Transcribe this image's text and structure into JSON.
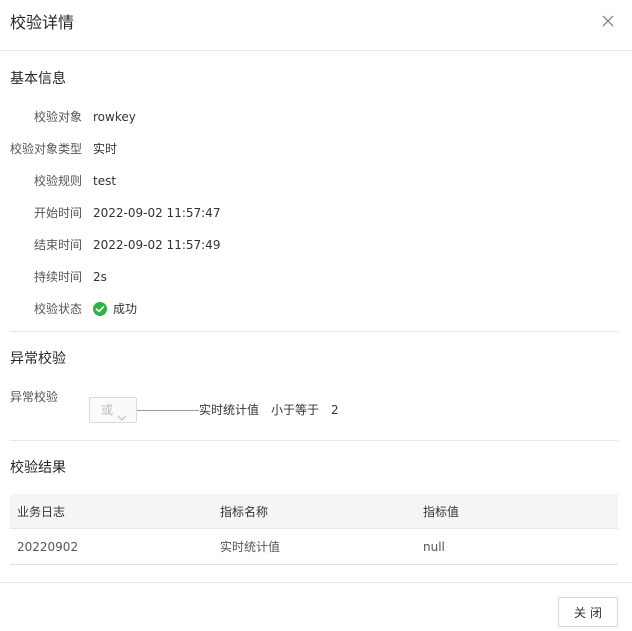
{
  "dialog": {
    "title": "校验详情",
    "close_icon": "close-icon"
  },
  "basic_info": {
    "title": "基本信息",
    "fields": [
      {
        "label": "校验对象",
        "value": "rowkey"
      },
      {
        "label": "校验对象类型",
        "value": "实时"
      },
      {
        "label": "校验规则",
        "value": "test"
      },
      {
        "label": "开始时间",
        "value": "2022-09-02 11:57:47"
      },
      {
        "label": "结束时间",
        "value": "2022-09-02 11:57:49"
      },
      {
        "label": "持续时间",
        "value": "2s"
      },
      {
        "label": "校验状态",
        "value": "成功",
        "icon": "check-circle-icon",
        "icon_color": "#2fb344"
      }
    ]
  },
  "anomaly": {
    "title": "异常校验",
    "label": "异常校验",
    "logic_select": "或",
    "conditions": [
      {
        "metric": "实时统计值",
        "operator": "小于等于",
        "value": "2"
      }
    ]
  },
  "results": {
    "title": "校验结果",
    "columns": [
      "业务日志",
      "指标名称",
      "指标值"
    ],
    "rows": [
      [
        "20220902",
        "实时统计值",
        "null"
      ]
    ]
  },
  "footer": {
    "close_label": "关闭"
  }
}
